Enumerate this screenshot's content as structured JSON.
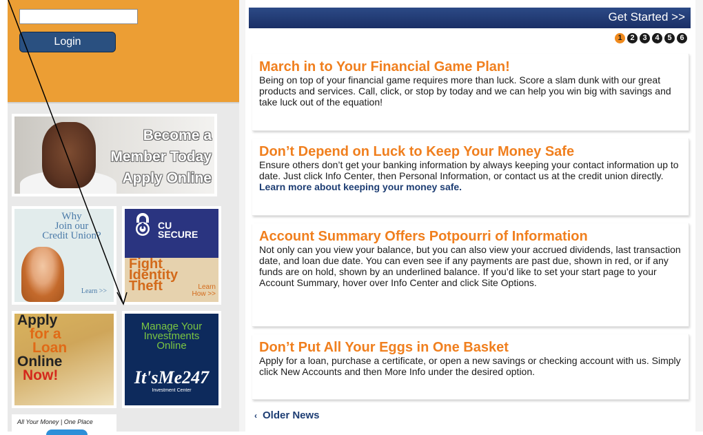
{
  "login": {
    "username_value": "",
    "button_label": "Login"
  },
  "promos": {
    "member": {
      "line1": "Become a",
      "line2": "Member Today",
      "line3": "Apply Online"
    },
    "why": {
      "line1": "Why",
      "line2": "Join our",
      "line3": "Credit Union?",
      "learn": "Learn >>"
    },
    "cusecure": {
      "logo1": "CU",
      "logo2": "SECURE",
      "fight1": "Fight",
      "fight2": "Identity",
      "fight3": "Theft",
      "learn1": "Learn",
      "learn2": "How >>"
    },
    "loan": {
      "line1": "Apply",
      "line2": "for a",
      "line3": "Loan",
      "line4": "Online",
      "line5": "Now!"
    },
    "invest": {
      "line1": "Manage Your",
      "line2": "Investments",
      "line3": "Online",
      "logo": "It'sMe247",
      "sub": "Investment Center"
    },
    "allmoney": {
      "text": "All Your Money | One Place"
    }
  },
  "header": {
    "get_started": "Get Started >>"
  },
  "pager": [
    "1",
    "2",
    "3",
    "4",
    "5",
    "6"
  ],
  "pager_active": "1",
  "news": [
    {
      "title": "March in to Your Financial Game Plan!",
      "body": "Being on top of your financial game requires more than luck. Score a slam dunk with our great products and services. Call, click, or stop by today and we can help you win big with savings and take luck out of the equation!",
      "link": ""
    },
    {
      "title": "Don’t Depend on Luck to Keep Your Money Safe",
      "body": "Ensure others don’t get your banking information by always keeping your contact information up to date. Just click Info Center, then Personal Information, or contact us at the credit union directly. ",
      "link": "Learn more about keeping your money safe."
    },
    {
      "title": "Account Summary Offers Potpourri of Information",
      "body": "Not only can you view your balance, but you can also view your accrued dividends, last transaction date, and loan due date. You can even see if any payments are past due, shown in red, or if any funds are on hold, shown by an underlined balance. If you’d like to set your start page to your Account Summary, hover over Info Center and click Site Options.",
      "link": ""
    },
    {
      "title": "Don’t Put All Your Eggs in One Basket",
      "body": "Apply for a loan, purchase a certificate, or open a new savings or checking account with us. Simply click New Accounts and then More Info under the desired option.",
      "link": ""
    }
  ],
  "older_news": "Older News",
  "colors": {
    "orange": "#f07f1e",
    "navy": "#1d3d73",
    "sidebar_orange": "#ec9e34"
  }
}
